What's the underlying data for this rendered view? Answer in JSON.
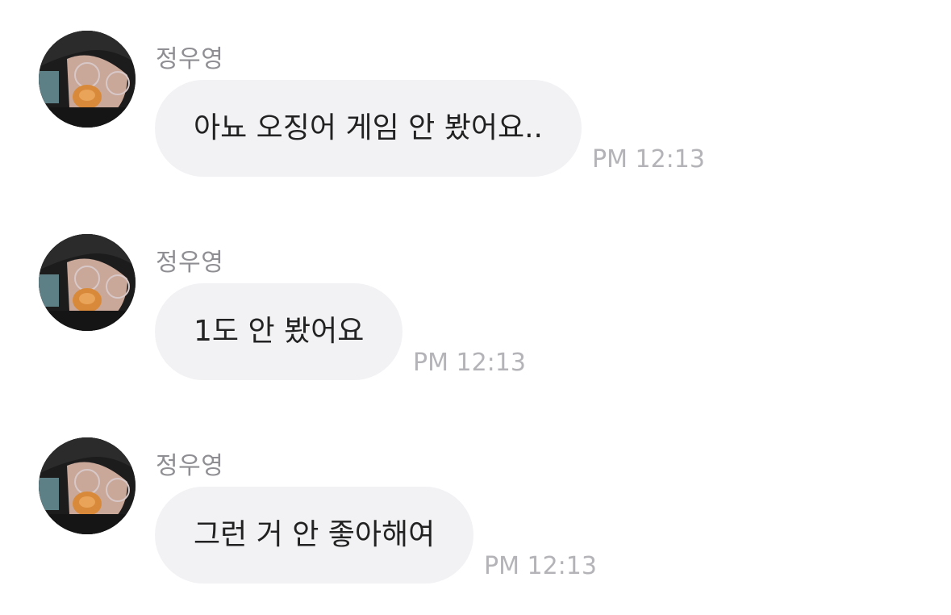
{
  "messages": [
    {
      "sender": "정우영",
      "text": "아뇨 오징어 게임 안 봤어요..",
      "time": "PM 12:13"
    },
    {
      "sender": "정우영",
      "text": "1도 안 봤어요",
      "time": "PM 12:13"
    },
    {
      "sender": "정우영",
      "text": "그런 거 안 좋아해여",
      "time": "PM 12:13"
    }
  ],
  "colors": {
    "bubble": "#f2f2f5",
    "text": "#222222",
    "sender": "#8e8e93",
    "time": "#b4b4b8"
  }
}
